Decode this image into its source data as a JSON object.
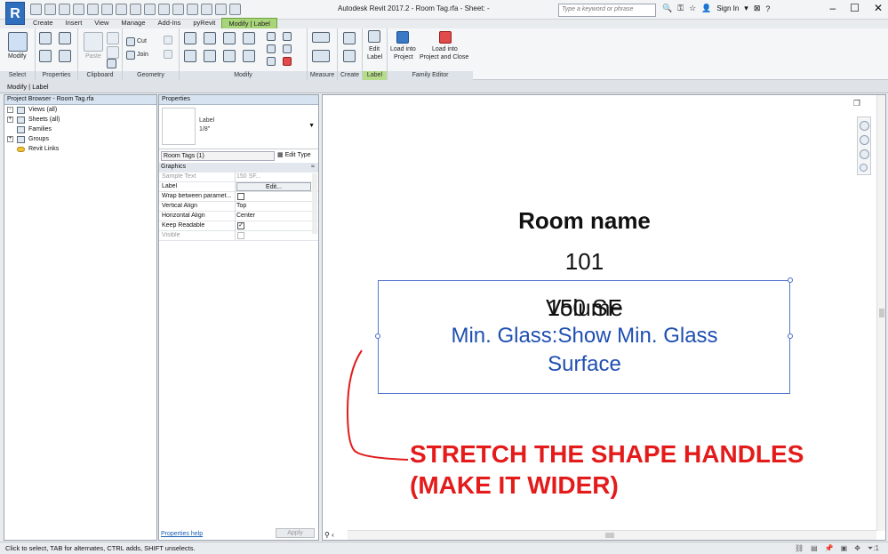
{
  "window": {
    "title": "Autodesk Revit 2017.2 -      Room Tag.rfa - Sheet: -",
    "app_letter": "R",
    "search_placeholder": "Type a keyword or phrase",
    "sign_in": "Sign In"
  },
  "tabs": [
    "Create",
    "Insert",
    "View",
    "Manage",
    "Add-Ins",
    "pyRevit",
    "Modify | Label"
  ],
  "ribbon": {
    "modify_label": "Modify",
    "select_label": "Select",
    "properties_label": "Properties",
    "paste_label": "Paste",
    "clipboard_label": "Clipboard",
    "cut_label": "Cut",
    "join_label": "Join",
    "geometry_label": "Geometry",
    "modify_panel_label": "Modify",
    "measure_label": "Measure",
    "create_label": "Create",
    "edit_label_line1": "Edit",
    "edit_label_line2": "Label",
    "label_panel_label": "Label",
    "load_project_line1": "Load into",
    "load_project_line2": "Project",
    "load_close_line1": "Load into",
    "load_close_line2": "Project and Close",
    "family_editor_label": "Family Editor"
  },
  "options_bar": "Modify | Label",
  "project_browser": {
    "title": "Project Browser - Room Tag.rfa",
    "items": [
      {
        "label": "Views (all)",
        "expander": "-"
      },
      {
        "label": "Sheets (all)",
        "expander": "+"
      },
      {
        "label": "Families",
        "expander": ""
      },
      {
        "label": "Groups",
        "expander": "+"
      },
      {
        "label": "Revit Links",
        "expander": ""
      }
    ]
  },
  "properties": {
    "title": "Properties",
    "type_name": "Label",
    "type_size": "1/8\"",
    "instance_filter": "Room Tags (1)",
    "edit_type": "Edit Type",
    "group": "Graphics",
    "rows": {
      "sample_text": {
        "name": "Sample Text",
        "value": "150 SF..."
      },
      "label": {
        "name": "Label",
        "value": "Edit..."
      },
      "wrap": {
        "name": "Wrap between paramet..."
      },
      "vertical_align": {
        "name": "Vertical Align",
        "value": "Top"
      },
      "horizontal_align": {
        "name": "Horizontal Align",
        "value": "Center"
      },
      "keep_readable": {
        "name": "Keep Readable",
        "value": "✓"
      },
      "visible": {
        "name": "Visible"
      }
    },
    "help_link": "Properties help",
    "apply": "Apply"
  },
  "canvas": {
    "room_name": "Room name",
    "room_number": "101",
    "area": "150 SF",
    "volume": "Volume",
    "glass_line1": "Min. Glass:Show Min. Glass",
    "glass_line2": "Surface",
    "annotation_line1": "STRETCH THE SHAPE HANDLES",
    "annotation_line2": "(MAKE IT WIDER)",
    "annotation_color": "#e31b1b",
    "label_color": "#1f4fb0"
  },
  "status_bar": {
    "text": "Click to select, TAB for alternates, CTRL adds, SHIFT unselects.",
    "filter_count": ":1"
  }
}
